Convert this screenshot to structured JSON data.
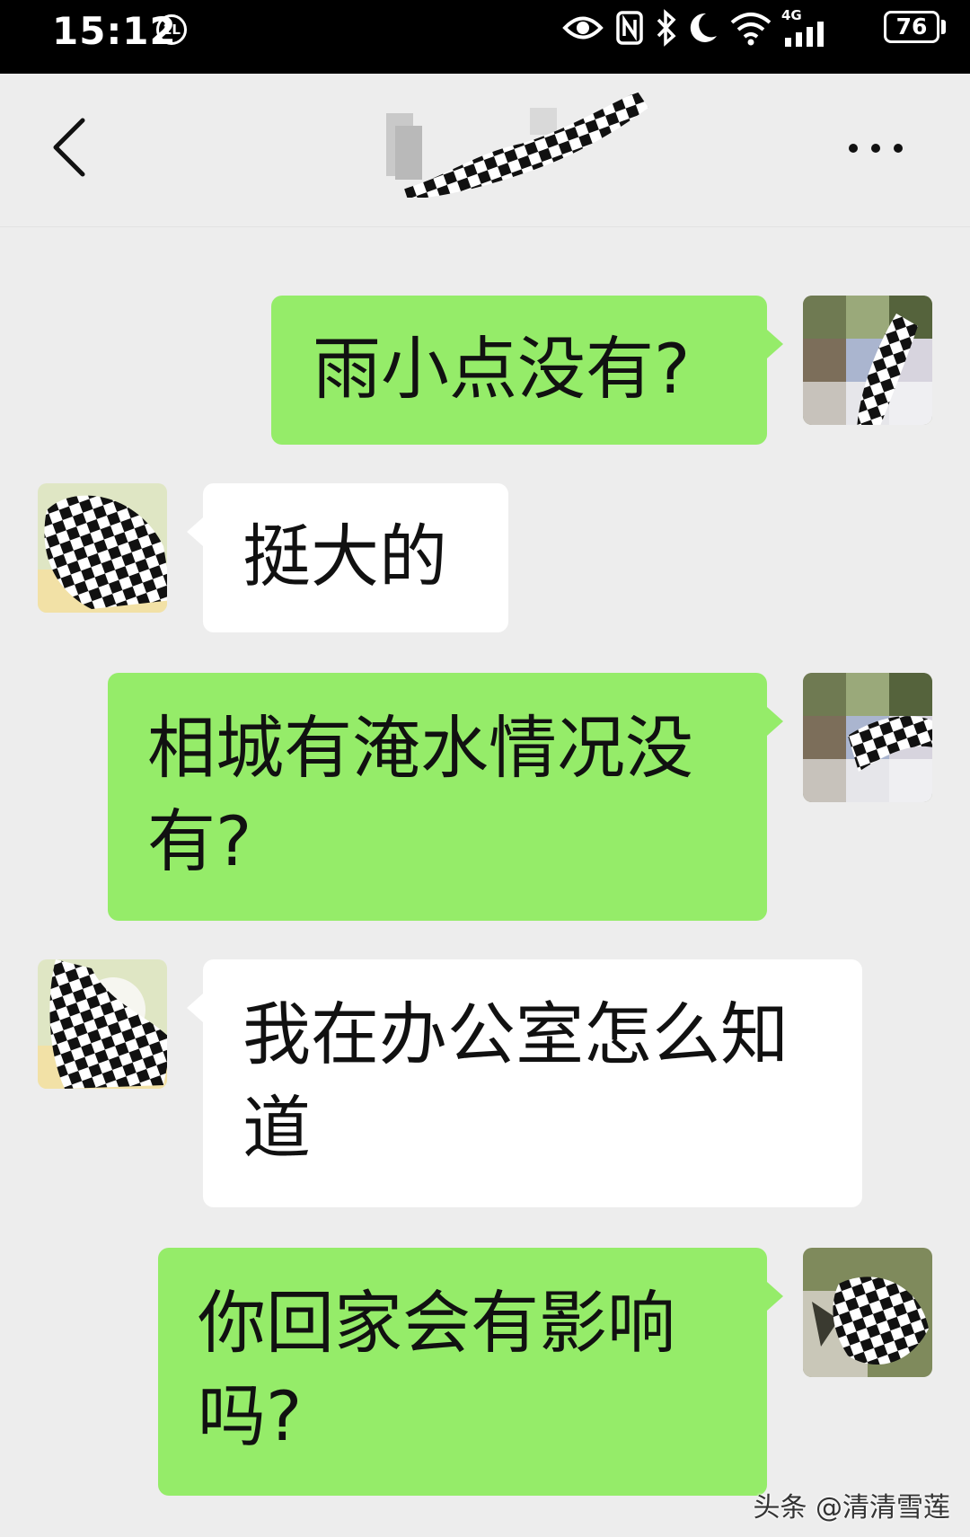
{
  "status_bar": {
    "time": "15:12",
    "time_badge": "1L",
    "network": "4G",
    "battery": "76"
  },
  "messages": [
    {
      "side": "sent",
      "text": "雨小点没有?"
    },
    {
      "side": "received",
      "text": "挺大的"
    },
    {
      "side": "sent",
      "text": "相城有淹水情况没有?"
    },
    {
      "side": "received",
      "text": "我在办公室怎么知道"
    },
    {
      "side": "sent",
      "text": "你回家会有影响吗?"
    }
  ],
  "watermark": "头条 @清清雪莲",
  "colors": {
    "status_bar_bg": "#000000",
    "chat_bg": "#ededed",
    "sent_bubble": "#95ec69",
    "received_bubble": "#ffffff"
  },
  "icons": {
    "back": "chevron-left-icon",
    "more": "more-horizontal-icon",
    "eye": "eye-icon",
    "nfc": "nfc-icon",
    "bluetooth": "bluetooth-icon",
    "do_not_disturb": "moon-icon",
    "wifi": "wifi-icon",
    "signal": "signal-icon",
    "battery": "battery-icon"
  }
}
